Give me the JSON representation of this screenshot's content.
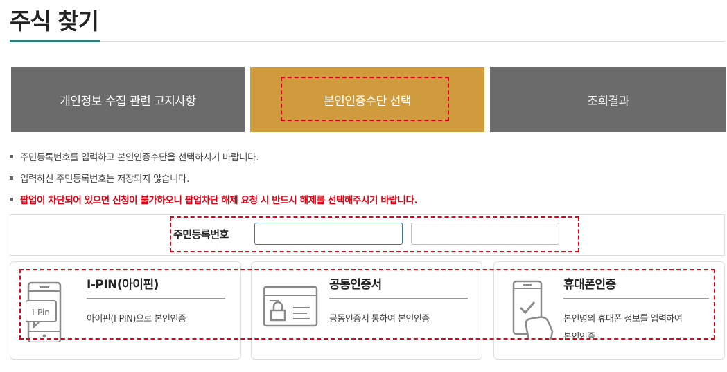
{
  "page": {
    "title": "주식 찾기"
  },
  "steps": [
    {
      "label": "개인정보 수집 관련 고지사항"
    },
    {
      "label": "본인인증수단 선택"
    },
    {
      "label": "조회결과"
    }
  ],
  "notices": [
    "주민등록번호를 입력하고 본인인증수단을 선택하시기 바랍니다.",
    "입력하신 주민등록번호는 저장되지 않습니다.",
    "팝업이 차단되어 있으면 신청이 불가하오니 팝업차단 해제 요청 시 반드시 해제를 선택해주시기 바랍니다."
  ],
  "id_form": {
    "label": "주민등록번호",
    "first_value": "",
    "second_value": ""
  },
  "methods": [
    {
      "title": "I-PIN(아이핀)",
      "desc": "아이핀(I-PIN)으로 본인인증",
      "icon": "ipin-icon",
      "icon_text": "I-Pin"
    },
    {
      "title": "공동인증서",
      "desc": "공동인증서 통하여 본인인증",
      "icon": "certificate-icon"
    },
    {
      "title": "휴대폰인증",
      "desc_line1": "본인명의 휴대폰 정보를 입력하여",
      "desc_line2": "본인인증",
      "icon": "mobile-phone-icon"
    }
  ],
  "colors": {
    "active_step": "#cf9b3c",
    "inactive_step": "#6b6b6b",
    "accent": "#2c7a72",
    "highlight": "#e60012"
  }
}
